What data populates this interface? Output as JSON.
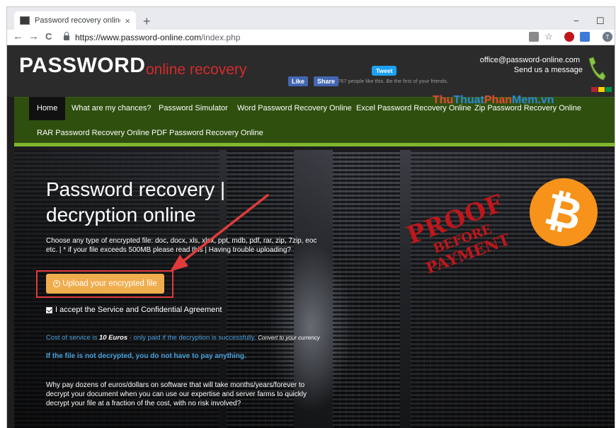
{
  "browser": {
    "tab_title": "Password recovery online excel, v",
    "tab_close": "×",
    "new_tab": "+",
    "minimize": "−",
    "maximize": "☐",
    "back": "←",
    "forward": "→",
    "reload": "C",
    "url_host": "https://www.password-online.com",
    "url_path": "/index.php",
    "extensions": [
      "translate-icon",
      "star-icon",
      "abp-icon",
      "cast-icon",
      "profile-icon"
    ],
    "profile_letter": "T",
    "star": "☆"
  },
  "site": {
    "logo_main": "PASSWORD",
    "logo_sub": "online recovery",
    "fb_like": "Like",
    "fb_share": "Share",
    "fb_text": "767 people like this. Be the first of your friends.",
    "tweet": "Tweet",
    "contact_email": "office@password-online.com",
    "contact_message": "Send us a message",
    "colors": {
      "accent_green": "#7fb82e",
      "nav_bg": "#2f4f0f",
      "logo_red": "#d52b2b",
      "link_blue": "#4aa3df",
      "button_orange": "#f0ad4e"
    }
  },
  "nav": {
    "items": [
      "Home",
      "What are my chances?",
      "Password Simulator",
      "Word Password Recovery Online",
      "Excel Password Recovery Online",
      "Zip Password Recovery Online",
      "RAR Password Recovery Online",
      "PDF Password Recovery Online"
    ]
  },
  "hero": {
    "title": "Password recovery | decryption online",
    "description": "Choose any type of encrypted file: doc, docx, xls, xlsx, ppt, mdb, pdf, rar, zip, 7zip, eoc etc.   |  * if your file exceeds 500MB please read this   |  Having trouble uploading?",
    "upload_button": "Upload your encrypted file",
    "agree_text": "I accept the Service and Confidential Agreement",
    "cost_prefix": "Cost of service is ",
    "cost_amount": "10 Euros",
    "cost_suffix": " - only paid if the decryption is successfully. ",
    "cost_convert": "Convert to your currency",
    "cost_strong": "If the file is not decrypted, you do not have to pay anything.",
    "why": "Why pay dozens of euros/dollars on software that will take months/years/forever to decrypt your document when you can use our expertise and server farms to quickly decrypt your file at a fraction of the cost, with no risk involved?",
    "proof_line1": "PROOF",
    "proof_line2": "BEFORE",
    "proof_line3": "PAYMENT",
    "bitcoin_symbol": "₿"
  },
  "watermark": {
    "part1": "Thu",
    "part2": "Thuat",
    "part3": "Phan",
    "part4": "Mem.vn"
  }
}
